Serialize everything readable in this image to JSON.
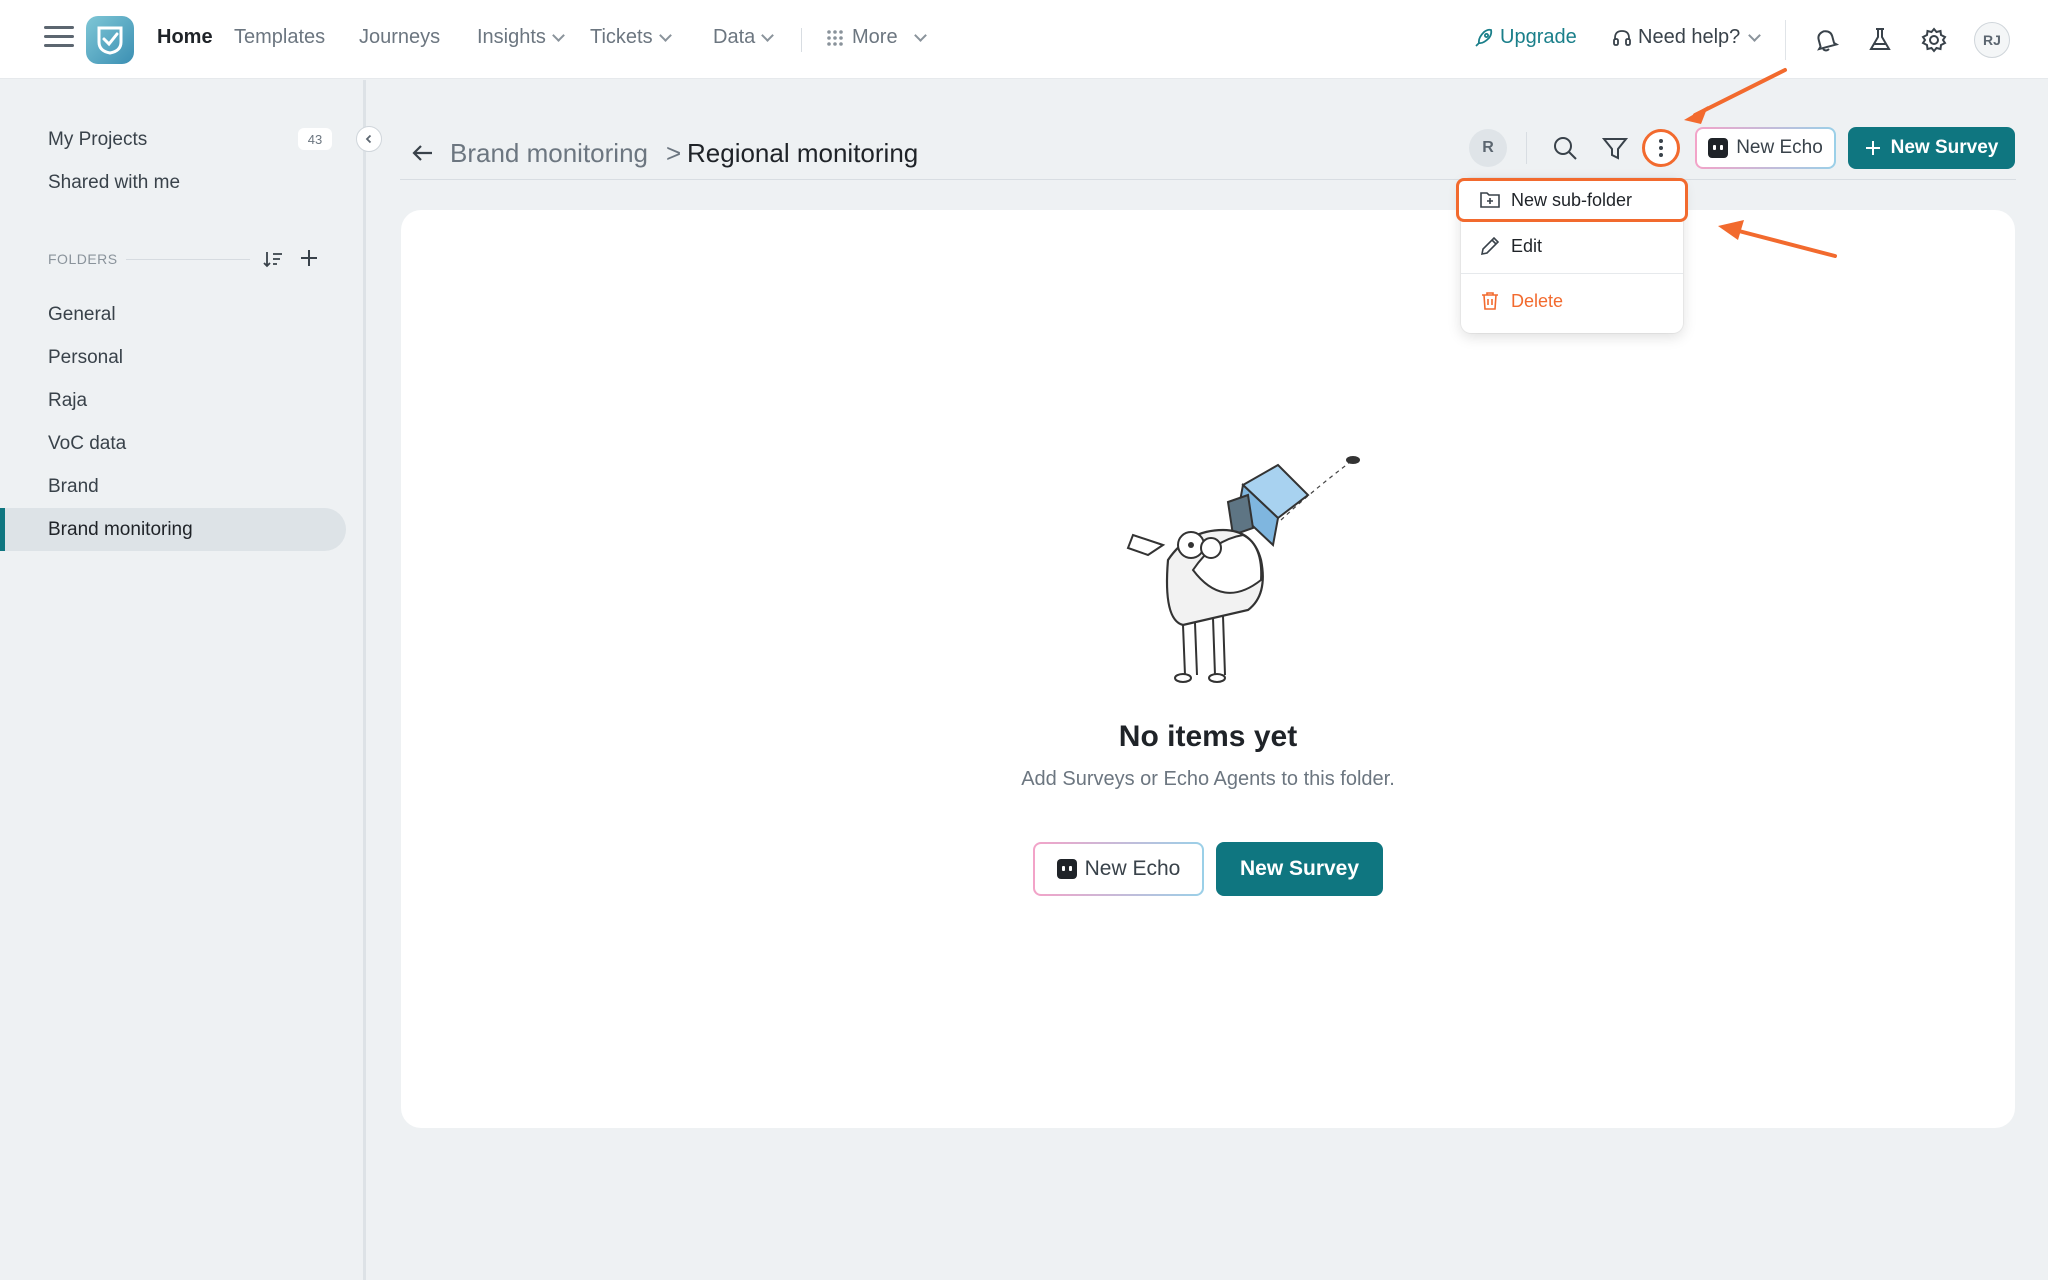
{
  "nav": {
    "items": [
      {
        "label": "Home",
        "active": true,
        "dropdown": false
      },
      {
        "label": "Templates",
        "active": false,
        "dropdown": false
      },
      {
        "label": "Journeys",
        "active": false,
        "dropdown": false
      },
      {
        "label": "Insights",
        "active": false,
        "dropdown": true
      },
      {
        "label": "Tickets",
        "active": false,
        "dropdown": true
      },
      {
        "label": "Data",
        "active": false,
        "dropdown": true
      },
      {
        "label": "More",
        "active": false,
        "dropdown": true
      }
    ],
    "upgrade_label": "Upgrade",
    "help_label": "Need help?",
    "avatar_initials": "RJ"
  },
  "sidebar": {
    "my_projects": "My Projects",
    "my_projects_count": "43",
    "shared_with_me": "Shared with me",
    "folders_heading": "FOLDERS",
    "folders": [
      {
        "label": "General",
        "active": false
      },
      {
        "label": "Personal",
        "active": false
      },
      {
        "label": "Raja",
        "active": false
      },
      {
        "label": "VoC data",
        "active": false
      },
      {
        "label": "Brand",
        "active": false
      },
      {
        "label": "Brand monitoring",
        "active": true
      }
    ]
  },
  "header": {
    "breadcrumb_parent": "Brand monitoring",
    "breadcrumb_sep": ">",
    "breadcrumb_current": "Regional monitoring",
    "member_initial": "R",
    "new_echo_label": "New Echo",
    "new_survey_label": "New Survey"
  },
  "menu": {
    "items": [
      {
        "label": "New sub-folder",
        "icon": "folder-plus-icon",
        "highlighted": true
      },
      {
        "label": "Edit",
        "icon": "pencil-icon",
        "highlighted": false
      },
      {
        "label": "Delete",
        "icon": "trash-icon",
        "danger": true
      }
    ]
  },
  "empty_state": {
    "title": "No items yet",
    "subtitle": "Add Surveys or Echo Agents to this folder.",
    "new_echo_label": "New Echo",
    "new_survey_label": "New Survey"
  },
  "colors": {
    "primary": "#0f7680",
    "accent_annotation": "#f26a2e",
    "background": "#eef1f3"
  }
}
